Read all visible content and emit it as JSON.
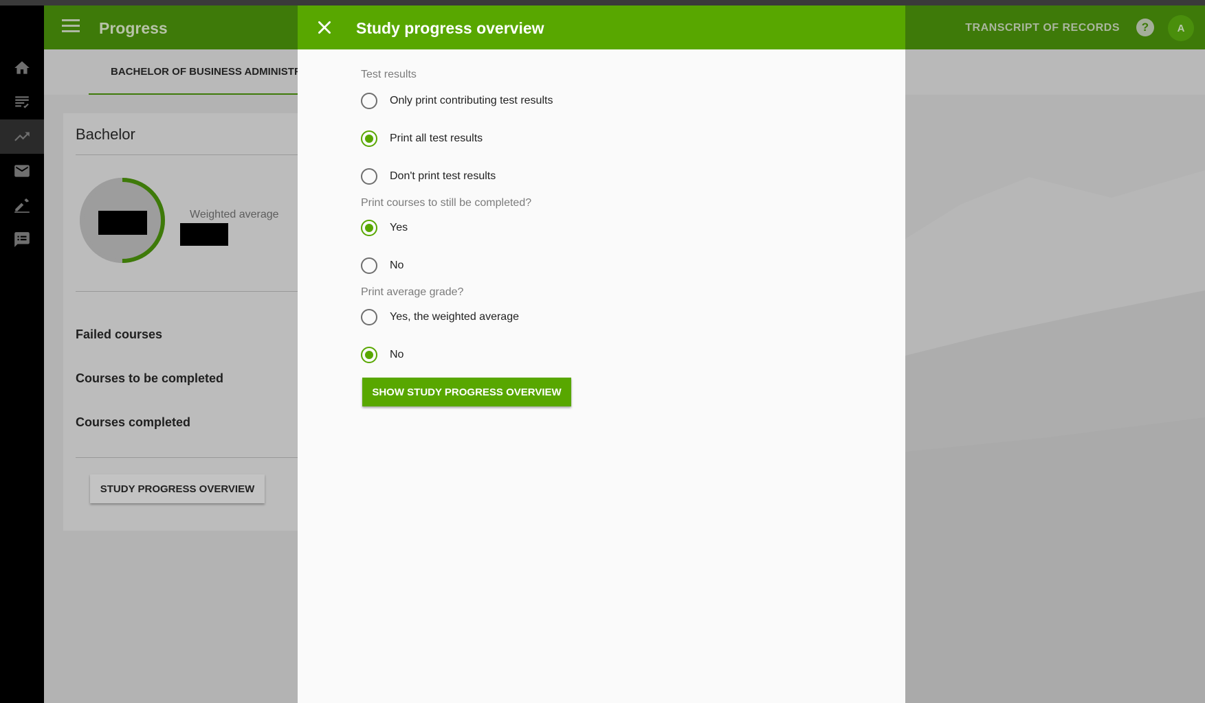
{
  "app": {
    "title": "Progress",
    "transcript_link": "TRANSCRIPT OF RECORDS",
    "help_symbol": "?",
    "avatar_initial": "A"
  },
  "rail": {
    "icons": [
      "home-icon",
      "assignment-icon",
      "trending-up-icon",
      "mail-icon",
      "edit-icon",
      "feedback-icon"
    ],
    "active": "trending-up-icon"
  },
  "tabs": [
    {
      "label": "BACHELOR OF BUSINESS ADMINISTR",
      "active": true
    }
  ],
  "card": {
    "title": "Bachelor",
    "weighted_average_label": "Weighted average",
    "progress_fraction": 0.5,
    "rows": [
      "Failed courses",
      "Courses to be completed",
      "Courses completed"
    ],
    "button": "STUDY PROGRESS OVERVIEW"
  },
  "dialog": {
    "title": "Study progress overview",
    "sections": [
      {
        "label": "Test results",
        "options": [
          {
            "label": "Only print contributing test results",
            "checked": false
          },
          {
            "label": "Print all test results",
            "checked": true
          },
          {
            "label": "Don't print test results",
            "checked": false
          }
        ]
      },
      {
        "label": "Print courses to still be completed?",
        "options": [
          {
            "label": "Yes",
            "checked": true
          },
          {
            "label": "No",
            "checked": false
          }
        ]
      },
      {
        "label": "Print average grade?",
        "options": [
          {
            "label": "Yes, the weighted average",
            "checked": false
          },
          {
            "label": "No",
            "checked": true
          }
        ]
      }
    ],
    "submit": "SHOW STUDY PROGRESS OVERVIEW"
  },
  "colors": {
    "header": "#3e7a09",
    "accent": "#58a700",
    "rail": "#000000"
  }
}
